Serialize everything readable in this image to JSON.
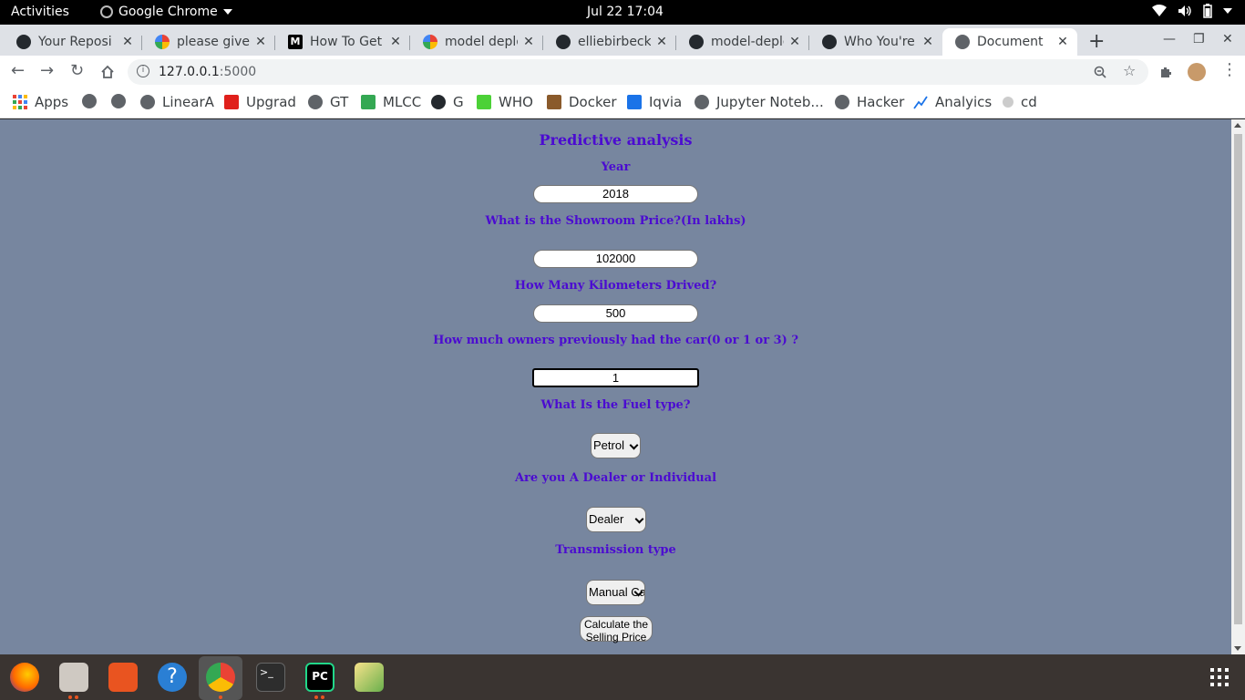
{
  "system_bar": {
    "activities": "Activities",
    "app_name": "Google Chrome",
    "clock": "Jul 22  17:04"
  },
  "tabs": [
    {
      "title": "Your Reposi",
      "favicon": "github-icon"
    },
    {
      "title": "please give s",
      "favicon": "google-icon"
    },
    {
      "title": "How To Get",
      "favicon": "medium-icon"
    },
    {
      "title": "model deplo",
      "favicon": "google-icon"
    },
    {
      "title": "elliebirbeck",
      "favicon": "github-icon"
    },
    {
      "title": "model-deplo",
      "favicon": "github-icon"
    },
    {
      "title": "Who You're",
      "favicon": "github-icon"
    },
    {
      "title": "Document",
      "favicon": "globe-icon",
      "active": true
    }
  ],
  "address_bar": {
    "host": "127.0.0.1",
    "port": ":5000"
  },
  "bookmarks": [
    {
      "label": "Apps"
    },
    {
      "label": ""
    },
    {
      "label": ""
    },
    {
      "label": "LinearA"
    },
    {
      "label": "Upgrad"
    },
    {
      "label": "GT"
    },
    {
      "label": "MLCC"
    },
    {
      "label": "G"
    },
    {
      "label": "WHO"
    },
    {
      "label": "Docker"
    },
    {
      "label": "Iqvia"
    },
    {
      "label": "Jupyter Noteb..."
    },
    {
      "label": "Hacker"
    },
    {
      "label": "Analyics"
    },
    {
      "label": "cd"
    }
  ],
  "form": {
    "heading": "Predictive analysis",
    "year_label": "Year",
    "year_value": "2018",
    "price_label": "What is the Showroom Price?(In lakhs)",
    "price_value": "102000",
    "km_label": "How Many Kilometers Drived?",
    "km_value": "500",
    "owners_label": "How much owners previously had the car(0 or 1 or 3) ?",
    "owners_value": "1",
    "fuel_label": "What Is the Fuel type?",
    "fuel_value": "Petrol",
    "seller_label": "Are you A Dealer or Individual",
    "seller_value": "Dealer",
    "transmission_label": "Transmission type",
    "transmission_value": "Manual Car",
    "submit_label": "Calculate the Selling Price"
  },
  "colors": {
    "page_bg": "#77869f",
    "label_color": "#4b0bd1"
  }
}
